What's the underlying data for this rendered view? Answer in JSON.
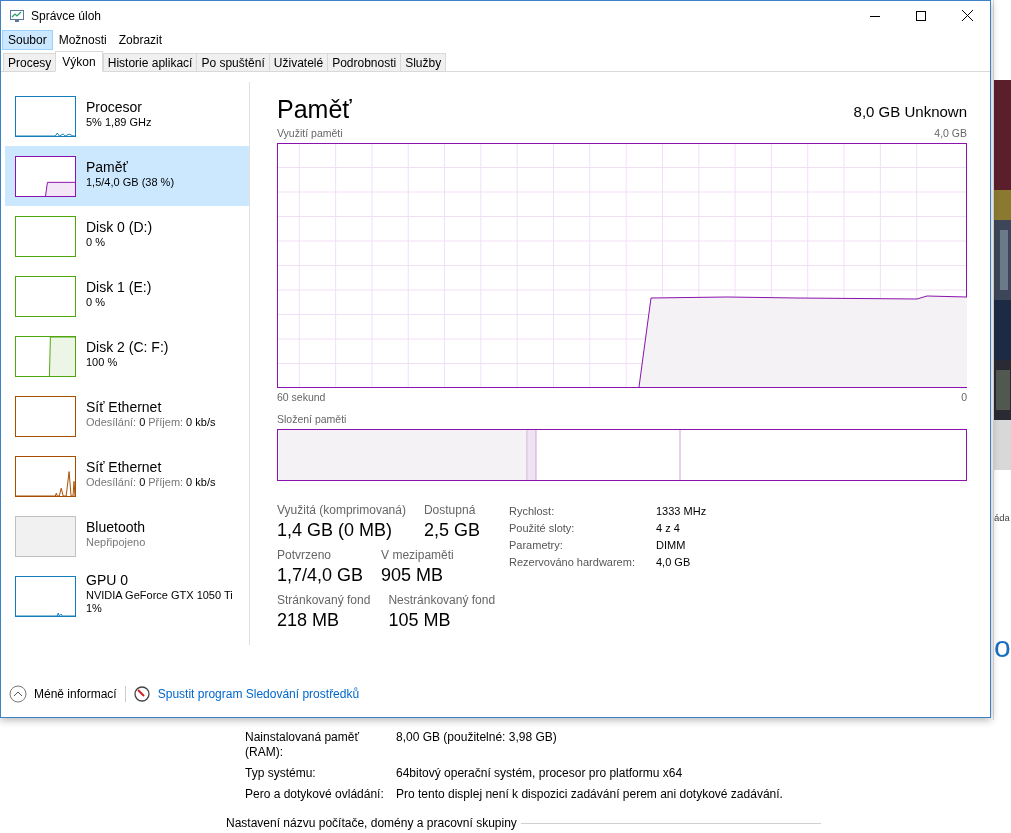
{
  "background_window": {
    "right_edge_text": "áda",
    "right_edge_heading": "o",
    "rows": [
      {
        "label": "Nainstalovaná paměť (RAM):",
        "value": "8,00 GB (použitelné: 3,98 GB)"
      },
      {
        "label": "Typ systému:",
        "value": "64bitový operační systém, procesor pro platformu x64"
      },
      {
        "label": "Pero a dotykové ovládání:",
        "value": "Pro tento displej není k dispozici zadávání perem ani dotykové zadávání."
      }
    ],
    "section_title": "Nastavení názvu počítače, domény a pracovní skupiny"
  },
  "window": {
    "title": "Správce úloh"
  },
  "menu": [
    {
      "label": "Soubor",
      "selected": true
    },
    {
      "label": "Možnosti",
      "selected": false
    },
    {
      "label": "Zobrazit",
      "selected": false
    }
  ],
  "tabs": [
    {
      "label": "Procesy",
      "selected": false
    },
    {
      "label": "Výkon",
      "selected": true
    },
    {
      "label": "Historie aplikací",
      "selected": false
    },
    {
      "label": "Po spuštění",
      "selected": false
    },
    {
      "label": "Uživatelé",
      "selected": false
    },
    {
      "label": "Podrobnosti",
      "selected": false
    },
    {
      "label": "Služby",
      "selected": false
    }
  ],
  "sidebar": {
    "items": [
      {
        "kind": "cpu",
        "color": "#117dbb",
        "name": "Procesor",
        "lines": [
          "5%  1,89 GHz"
        ],
        "selected": false
      },
      {
        "kind": "memory",
        "color": "#8b12ae",
        "name": "Paměť",
        "lines": [
          "1,5/4,0 GB (38 %)"
        ],
        "selected": true
      },
      {
        "kind": "disk_idle",
        "color": "#4da60c",
        "name": "Disk 0 (D:)",
        "lines": [
          "0 %"
        ],
        "selected": false
      },
      {
        "kind": "disk_idle",
        "color": "#4da60c",
        "name": "Disk 1 (E:)",
        "lines": [
          "0 %"
        ],
        "selected": false
      },
      {
        "kind": "disk_busy",
        "color": "#4da60c",
        "name": "Disk 2 (C: F:)",
        "lines": [
          "100 %"
        ],
        "selected": false
      },
      {
        "kind": "network_idle",
        "color": "#a74f01",
        "name": "Síť Ethernet",
        "stats": [
          {
            "label": "Odesílání:",
            "value": "0"
          },
          {
            "label": "Příjem:",
            "value": "0 kb/s"
          }
        ],
        "selected": false
      },
      {
        "kind": "network_spikes",
        "color": "#a74f01",
        "name": "Síť Ethernet",
        "stats": [
          {
            "label": "Odesílání:",
            "value": "0"
          },
          {
            "label": "Příjem:",
            "value": "0 kb/s"
          }
        ],
        "selected": false
      },
      {
        "kind": "disconnected",
        "color": "#c0c0c0",
        "name": "Bluetooth",
        "muted_lines": [
          "Nepřipojeno"
        ],
        "selected": false
      },
      {
        "kind": "gpu",
        "color": "#117dbb",
        "name": "GPU 0",
        "lines": [
          "NVIDIA GeForce GTX 1050 Ti",
          "1%"
        ],
        "selected": false
      }
    ]
  },
  "detail": {
    "title": "Paměť",
    "subtitle": "8,0 GB Unknown",
    "graph": {
      "label": "Využití paměti",
      "max_label": "4,0 GB",
      "time_label": "60 sekund",
      "min_label": "0"
    },
    "composition_label": "Složení paměti",
    "stats": [
      {
        "label": "Využitá (komprimovaná)",
        "value": "1,4 GB (0 MB)"
      },
      {
        "label": "Dostupná",
        "value": "2,5 GB"
      },
      {
        "label": "Potvrzeno",
        "value": "1,7/4,0 GB"
      },
      {
        "label": "V mezipaměti",
        "value": "905 MB"
      },
      {
        "label": "Stránkovaný fond",
        "value": "218 MB"
      },
      {
        "label": "Nestránkovaný fond",
        "value": "105 MB"
      }
    ],
    "properties": [
      {
        "label": "Rychlost:",
        "value": "1333 MHz"
      },
      {
        "label": "Použité sloty:",
        "value": "4 z 4"
      },
      {
        "label": "Parametry:",
        "value": "DIMM"
      },
      {
        "label": "Rezervováno hardwarem:",
        "value": "4,0 GB"
      }
    ]
  },
  "footer": {
    "less_info": "Méně informací",
    "resource_monitor": "Spustit program Sledování prostředků"
  }
}
